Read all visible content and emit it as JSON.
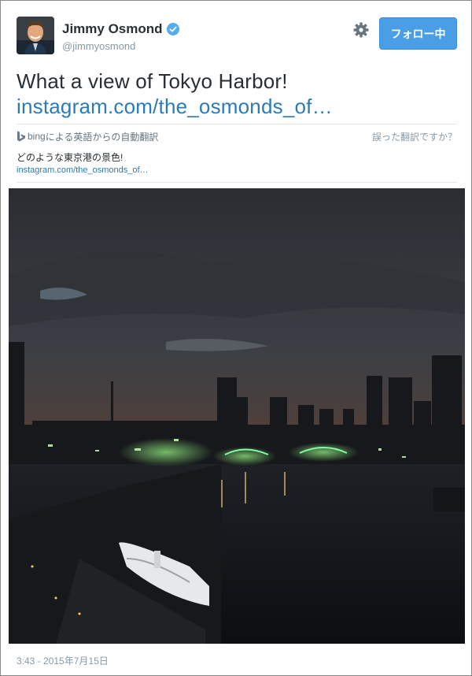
{
  "user": {
    "name": "Jimmy Osmond",
    "handle": "@jimmyosmond",
    "avatar_icon": "user-avatar-photo",
    "verified_icon": "verified-badge-icon"
  },
  "actions": {
    "settings_icon": "gear-icon",
    "follow_label": "フォロー中"
  },
  "tweet": {
    "text": "What a view of Tokyo Harbor!",
    "link": "instagram.com/the_osmonds_of…"
  },
  "translation": {
    "bing_label": "bing",
    "source_note": "による英語からの自動翻訳",
    "wrong_label": "誤った翻訳ですか？",
    "text": "どのような東京港の景色!",
    "link": "instagram.com/the_osmonds_of…"
  },
  "media": {
    "description_icon": "photo-tokyo-harbor-night"
  },
  "timestamp": "3:43 - 2015年7月15日",
  "colors": {
    "link": "#2b7bb9",
    "follow_button": "#4a9ee5",
    "verified": "#55acee",
    "muted": "#8899a6"
  }
}
